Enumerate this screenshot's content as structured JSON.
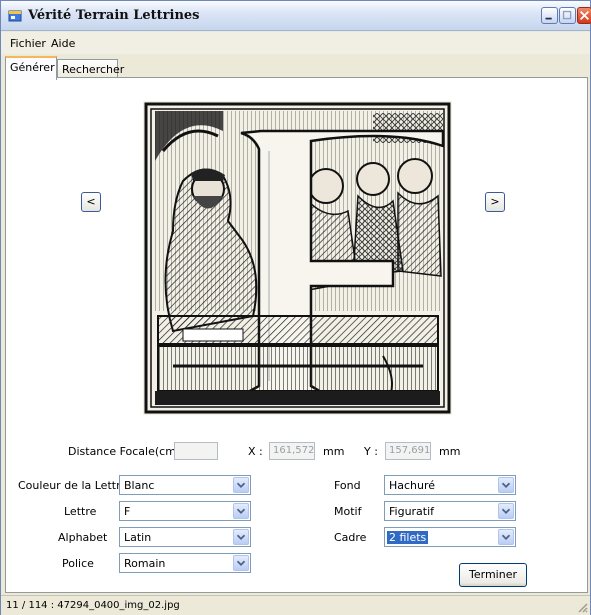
{
  "window": {
    "title": "Vérité Terrain Lettrines"
  },
  "menu": {
    "file": "Fichier",
    "help": "Aide"
  },
  "tabs": {
    "generate": "Générer",
    "search": "Rechercher"
  },
  "nav": {
    "prev": "<",
    "next": ">"
  },
  "image": {
    "letter_depicted": "F",
    "icon": "ornamental-letter-image"
  },
  "focal": {
    "label": "Distance Focale(cm) :",
    "value": ""
  },
  "coords": {
    "x_label": "X :",
    "x_value": "161,572",
    "x_unit": "mm",
    "y_label": "Y :",
    "y_value": "157,691",
    "y_unit": "mm"
  },
  "fields": {
    "couleur_label": "Couleur de la Lettre",
    "couleur_value": "Blanc",
    "lettre_label": "Lettre",
    "lettre_value": "F",
    "alphabet_label": "Alphabet",
    "alphabet_value": "Latin",
    "police_label": "Police",
    "police_value": "Romain",
    "fond_label": "Fond",
    "fond_value": "Hachuré",
    "motif_label": "Motif",
    "motif_value": "Figuratif",
    "cadre_label": "Cadre",
    "cadre_value": "2 filets"
  },
  "buttons": {
    "terminer": "Terminer"
  },
  "status": {
    "text": "11 / 114 : 47294_0400_img_02.jpg"
  },
  "colors": {
    "accent": "#316ac5",
    "tab_highlight": "#f4b85a"
  }
}
